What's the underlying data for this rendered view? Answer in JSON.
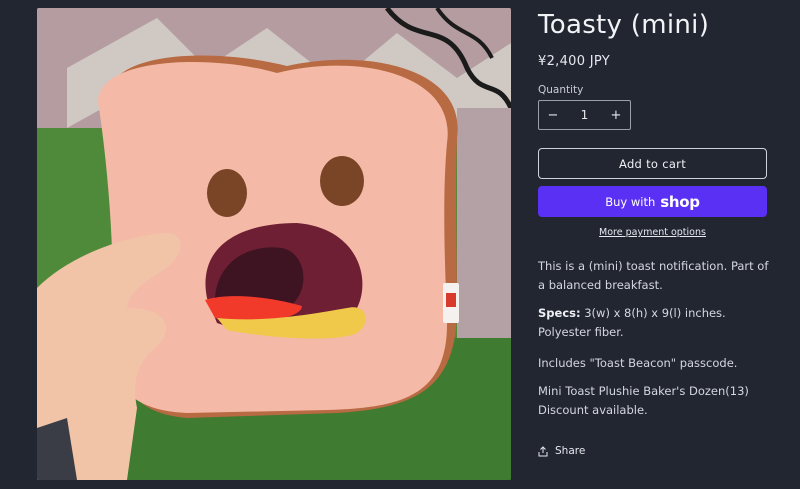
{
  "product": {
    "title": "Toasty (mini)",
    "price": "¥2,400 JPY",
    "image_alt": "Pink toast plushie with a surprised face held in a hand"
  },
  "quantity": {
    "label": "Quantity",
    "value": "1",
    "decrease_symbol": "−",
    "increase_symbol": "+"
  },
  "buttons": {
    "add_to_cart": "Add to cart",
    "buy_with": "Buy with",
    "buy_brand": "shop",
    "more_payment": "More payment options"
  },
  "description": {
    "intro": "This is a (mini) toast notification. Part of a balanced breakfast.",
    "specs_label": "Specs:",
    "specs_text": " 3(w) x 8(h) x 9(l) inches. Polyester fiber.",
    "includes": "Includes \"Toast Beacon\" passcode.",
    "discount": "Mini Toast Plushie Baker's Dozen(13) Discount available."
  },
  "share": {
    "label": "Share",
    "icon": "share-icon"
  },
  "colors": {
    "background": "#222631",
    "shop_purple": "#5a31f4"
  }
}
